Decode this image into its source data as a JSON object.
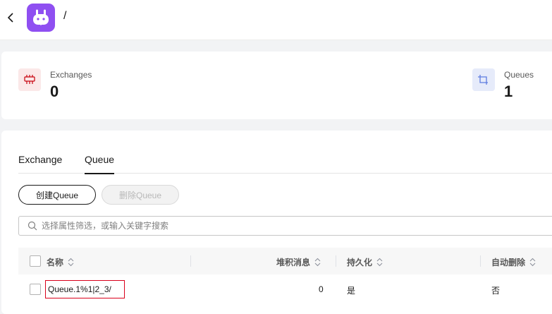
{
  "header": {
    "back_icon": "chevron-left-icon",
    "logo_icon": "bunny-logo-icon",
    "logo_color": "#8f4ff1",
    "vhost_name": "/"
  },
  "stats": {
    "exchanges": {
      "label": "Exchanges",
      "value": "0",
      "icon": "exchange-icon",
      "icon_color": "#c7000b"
    },
    "queues": {
      "label": "Queues",
      "value": "1",
      "icon": "queue-icon",
      "icon_color": "#5e7ce0"
    }
  },
  "tabs": [
    {
      "label": "Exchange",
      "active": false
    },
    {
      "label": "Queue",
      "active": true
    }
  ],
  "toolbar": {
    "create_label": "创建Queue",
    "delete_label": "删除Queue"
  },
  "search": {
    "placeholder": "选择属性筛选，或输入关键字搜索",
    "value": ""
  },
  "table": {
    "columns": [
      "名称",
      "堆积消息",
      "持久化",
      "自动删除"
    ],
    "rows": [
      {
        "name": "Queue.1%1|2_3/",
        "backlog": "0",
        "durable": "是",
        "auto_delete": "否"
      }
    ]
  },
  "colors": {
    "highlight_border": "#d9001b"
  }
}
